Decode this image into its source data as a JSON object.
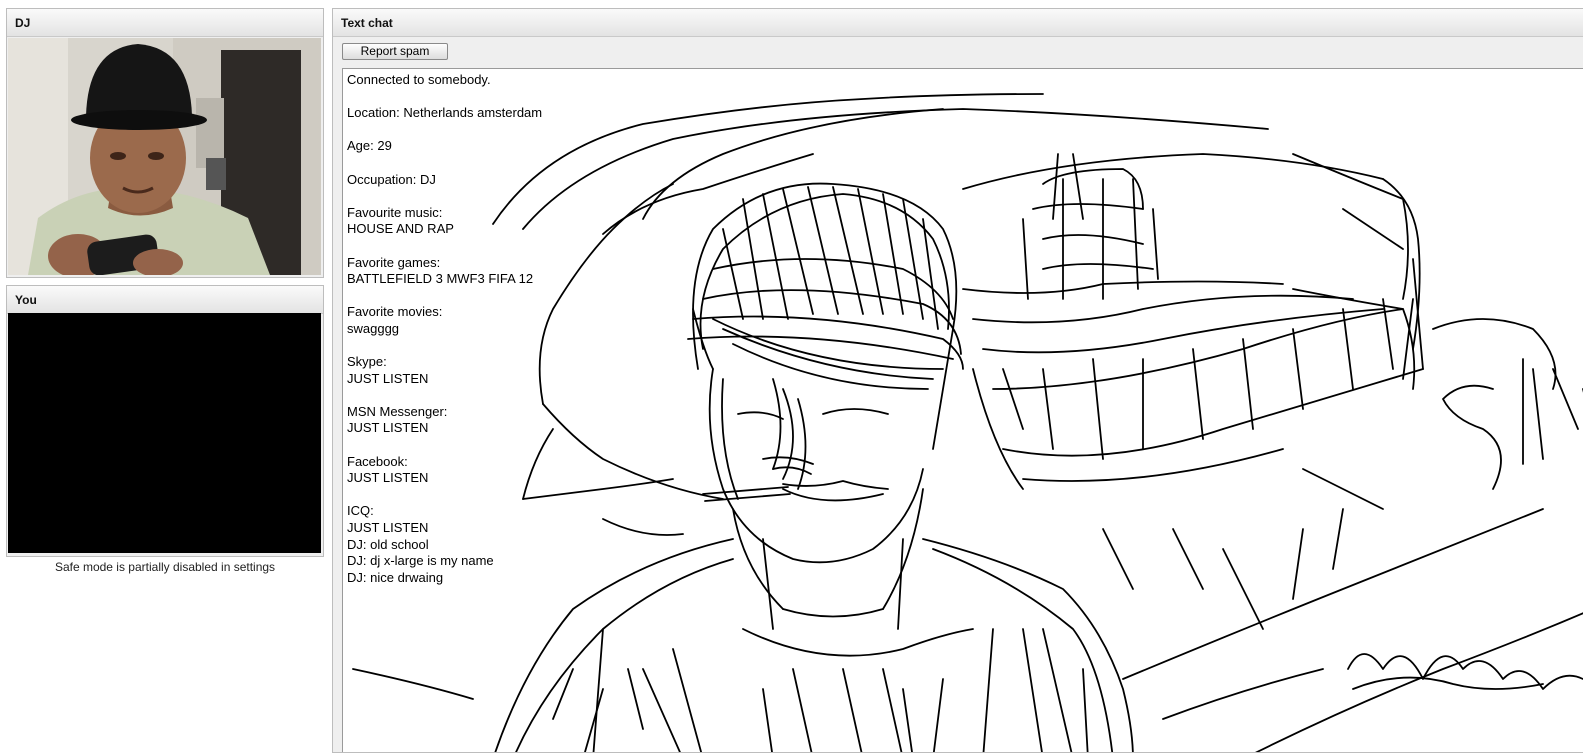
{
  "dj_panel": {
    "title": "DJ"
  },
  "you_panel": {
    "title": "You",
    "safe_mode_note": "Safe mode is partially disabled in settings"
  },
  "chat_panel": {
    "title": "Text chat",
    "report_spam_label": "Report spam",
    "messages": {
      "connected": "Connected to somebody.",
      "location": "Location: Netherlands amsterdam",
      "age": "Age: 29",
      "occupation": "Occupation: DJ",
      "music_label": "Favourite music:",
      "music_value": "HOUSE AND RAP",
      "games_label": "Favorite games:",
      "games_value": "BATTLEFIELD 3 MWF3 FIFA 12",
      "movies_label": "Favorite movies:",
      "movies_value": "swagggg",
      "skype_label": "Skype:",
      "skype_value": "JUST LISTEN",
      "msn_label": "MSN Messenger:",
      "msn_value": "JUST LISTEN",
      "facebook_label": "Facebook:",
      "facebook_value": "JUST LISTEN",
      "icq_label": "ICQ:",
      "icq_value": "JUST LISTEN",
      "dj_msg_1": "DJ: old school",
      "dj_msg_2": "DJ: dj x-large is my name",
      "dj_msg_3": "DJ: nice drwaing"
    }
  }
}
